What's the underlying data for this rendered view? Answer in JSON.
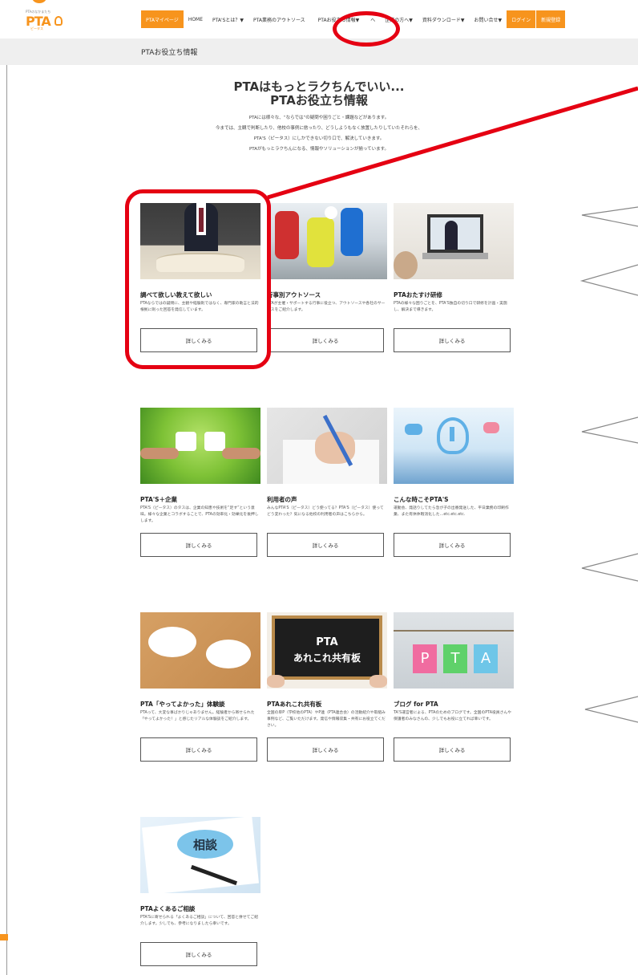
{
  "header": {
    "logo_small": "PTAのなかまたち",
    "logo_text": "PTA",
    "logo_kana": "ピータス",
    "nav": [
      {
        "label": "PTAマイページ",
        "highlight": true
      },
      {
        "label": "HOME",
        "highlight": false
      },
      {
        "label": "PTA'Sとは？▼",
        "highlight": false
      },
      {
        "label": "PTA業務のアウトソース",
        "highlight": false
      },
      {
        "label": "PTAお役立ち情報▼",
        "highlight": false
      },
      {
        "label": "へ",
        "highlight": false
      },
      {
        "label": "企業の方へ▼",
        "highlight": false
      },
      {
        "label": "資料ダウンロード▼",
        "highlight": false
      },
      {
        "label": "お問い合せ▼",
        "highlight": false
      },
      {
        "label": "ログイン",
        "highlight": true
      },
      {
        "label": "新規登録",
        "highlight": true
      }
    ]
  },
  "page_title": "PTAお役立ち情報",
  "hero": {
    "line1": "PTAはもっとラクちんでいい...",
    "line2": "PTAお役立ち情報",
    "paragraph": [
      "PTAには様々な、“ならでは”の疑問や困りごと・課題などがあります。",
      "今までは、主観で判断したり、他校の事例に倣ったり、どうしようもなく放置したりしていたそれらを、",
      "PTA'S（ピータス）にしかできない切り口で、解決していきます。",
      "PTAがもっとラクちんになる、情報やソリューションが揃っています。"
    ]
  },
  "button_label": "詳しくみる",
  "cards": [
    {
      "title": "調べて欲しい教えて欲しい",
      "desc": "PTAならではの疑問に、主観や経験則ではなく、専門家の助言と法的根拠に則った回答を発信しています。"
    },
    {
      "title": "行事別アウトソース",
      "desc": "PTAが主催・サポートする行事に役立つ、アウトソースや各社のサービスをご紹介します。"
    },
    {
      "title": "PTAおたすけ研修",
      "desc": "PTAの様々な困りごとを、PTA'S独自の切り口で研修を計画・実施し、解決まで導きます。"
    },
    {
      "title": "PTA'S＋企業",
      "desc": "PTA'S（ピータス）のタスは、企業の知恵や技術を“足す”という意味。様々な企業とコラボすることで、PTAの効率化・効果化を後押しします。"
    },
    {
      "title": "利用者の声",
      "desc": "みんなPTA'S（ピータス）どう使ってる？PTA'S（ピータス）使ってどう変わった？気になる他校の利用者の声はこちらから。"
    },
    {
      "title": "こんな時こそPTA'S",
      "desc": "運動会、発話りしてたら急が子の出番発送した、平日業務の印刷作業、また有休休暇消化した…etc.etc.etc."
    },
    {
      "title": "PTA「やってよかった」体験談",
      "desc": "PTAって、大変な事ばかりじゃありません。経験者から寄せられた「やってよかった！」と感じたリアルな体験談をご紹介します。"
    },
    {
      "title": "PTAあれこれ共有板",
      "desc": "全国の単P（学校他のPTA）やP連（PTA連合会）の活動紹介や取組み事例など、ご覧いただけます。発信や情報収集・共有にお役立てください。"
    },
    {
      "title": "ブログ for PTA",
      "desc": "TA'S運営者による、PTAのためのブログです。全国のPTA役員さんや保護者のみなさんの、少しでもお役に立てれば幸いです。"
    },
    {
      "title": "PTAよくあるご相談",
      "desc": "PTA'Sに寄せられる「よくあるご相談」について、回答と併せてご紹介します。少しでも、参考になりましたら幸いです。"
    }
  ],
  "image_text": {
    "chalkboard_line1": "PTA",
    "chalkboard_line2": "あれこれ共有板",
    "blog_letters": [
      "P",
      "T",
      "A"
    ],
    "consult": "相談"
  },
  "colors": {
    "accent": "#f7941d",
    "annotation": "#e50012"
  }
}
